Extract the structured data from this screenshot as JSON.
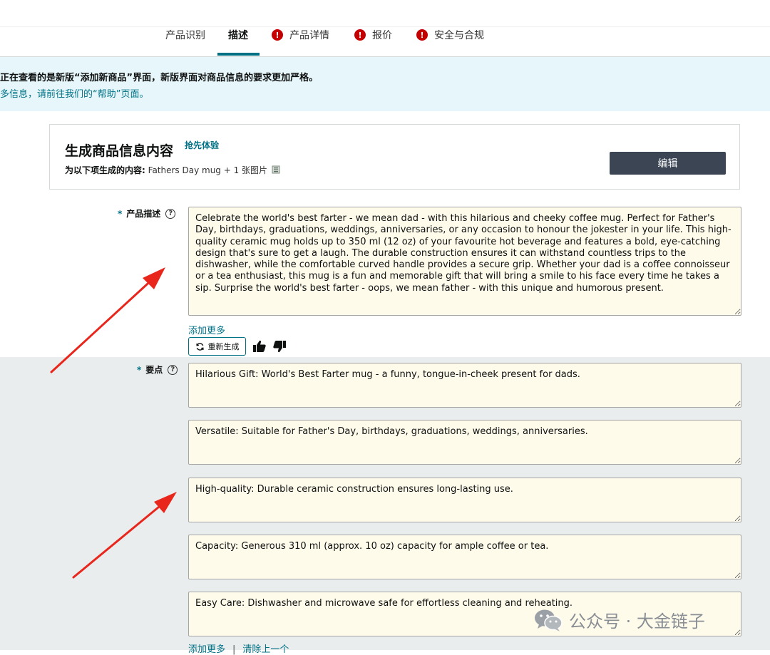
{
  "tabs": [
    {
      "label": "产品识别",
      "alert": false
    },
    {
      "label": "描述",
      "alert": false,
      "active": true
    },
    {
      "label": "产品详情",
      "alert": true
    },
    {
      "label": "报价",
      "alert": true
    },
    {
      "label": "安全与合规",
      "alert": true
    }
  ],
  "banner": {
    "line1": "正在查看的是新版“添加新商品”界面，新版界面对商品信息的要求更加严格。",
    "line2": "多信息，请前往我们的“帮助”页面。"
  },
  "generate": {
    "title": "生成商品信息内容",
    "badge": "抢先体验",
    "subtitle_label": "为以下项生成的内容:",
    "subtitle_value": "Fathers Day mug + 1 张图片",
    "edit_label": "编辑"
  },
  "description": {
    "label": "产品描述",
    "text": "Celebrate the world's best farter - we mean dad - with this hilarious and cheeky coffee mug. Perfect for Father's Day, birthdays, graduations, weddings, anniversaries, or any occasion to honour the jokester in your life. This high-quality ceramic mug holds up to 350 ml (12 oz) of your favourite hot beverage and features a bold, eye-catching design that's sure to get a laugh. The durable construction ensures it can withstand countless trips to the dishwasher, while the comfortable curved handle provides a secure grip. Whether your dad is a coffee connoisseur or a tea enthusiast, this mug is a fun and memorable gift that will bring a smile to his face every time he takes a sip. Surprise the world's best farter - oops, we mean father - with this unique and humorous present.",
    "add_more": "添加更多",
    "regenerate": "重新生成"
  },
  "bullets": {
    "label": "要点",
    "items": [
      "Hilarious Gift: World's Best Farter mug - a funny, tongue-in-cheek present for dads.",
      "Versatile: Suitable for Father's Day, birthdays, graduations, weddings, anniversaries.",
      "High-quality: Durable ceramic construction ensures long-lasting use.",
      "Capacity: Generous 310 ml (approx. 10 oz) capacity for ample coffee or tea.",
      "Easy Care: Dishwasher and microwave safe for effortless cleaning and reheating."
    ],
    "add_more": "添加更多",
    "remove_last": "清除上一个"
  },
  "watermark": {
    "text": "公众号 · 大金链子"
  },
  "colors": {
    "accent": "#007185",
    "alert": "#c40000",
    "field_bg": "#fffbeb",
    "banner_bg": "#e6f6fb",
    "arrow": "#e8261c"
  }
}
